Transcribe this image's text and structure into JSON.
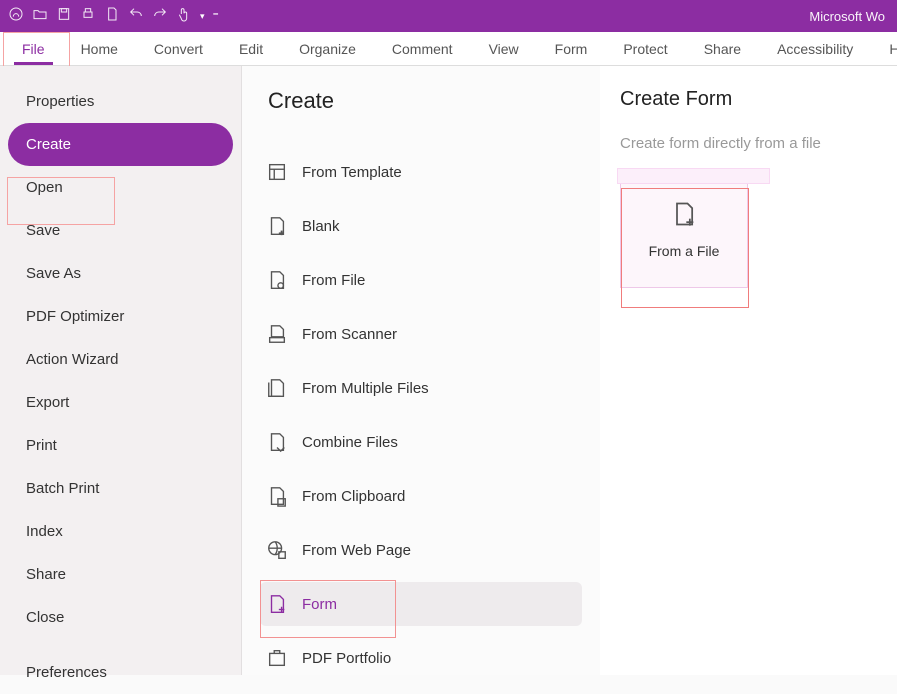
{
  "titlebar": {
    "app_text": "Microsoft Wo"
  },
  "ribbon": {
    "tabs": [
      "File",
      "Home",
      "Convert",
      "Edit",
      "Organize",
      "Comment",
      "View",
      "Form",
      "Protect",
      "Share",
      "Accessibility",
      "H"
    ]
  },
  "side_menu": {
    "items": [
      "Properties",
      "Create",
      "Open",
      "Save",
      "Save As",
      "PDF Optimizer",
      "Action Wizard",
      "Export",
      "Print",
      "Batch Print",
      "Index",
      "Share",
      "Close",
      "Preferences"
    ],
    "active_index": 1
  },
  "create_panel": {
    "heading": "Create",
    "items": [
      "From Template",
      "Blank",
      "From File",
      "From Scanner",
      "From Multiple Files",
      "Combine Files",
      "From Clipboard",
      "From Web Page",
      "Form",
      "PDF Portfolio"
    ],
    "selected_index": 8
  },
  "form_panel": {
    "heading": "Create Form",
    "subtitle": "Create form directly from a file",
    "tile_label": "From a File"
  },
  "colors": {
    "accent": "#8c2da2",
    "highlight": "#f29292"
  }
}
